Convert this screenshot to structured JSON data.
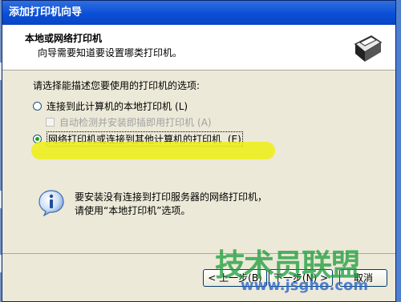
{
  "window": {
    "title": "添加打印机向导"
  },
  "header": {
    "title": "本地或网络打印机",
    "subtitle": "向导需要知道要设置哪类打印机。"
  },
  "content": {
    "prompt": "请选择能描述您要使用的打印机的选项:",
    "option_local": "连接到此计算机的本地打印机",
    "option_local_key": "(L)",
    "option_auto": "自动检测并安装即插即用打印机",
    "option_auto_key": "(A)",
    "option_network": "网络打印机或连接到其他计算机的打印机",
    "option_network_key": "(E)",
    "info_line1": "要安装没有连接到打印服务器的网络打印机，",
    "info_line2": "请使用“本地打印机”选项。"
  },
  "buttons": {
    "back": "< 上一步(B)",
    "next": "下一步(N) >",
    "cancel": "取消"
  },
  "watermark": {
    "text": "技术员联盟",
    "url": "www.jsgho.com"
  },
  "colors": {
    "titlebar": "#0a4fd6",
    "highlight": "#eeee14",
    "radio_selected": "#21a121"
  }
}
